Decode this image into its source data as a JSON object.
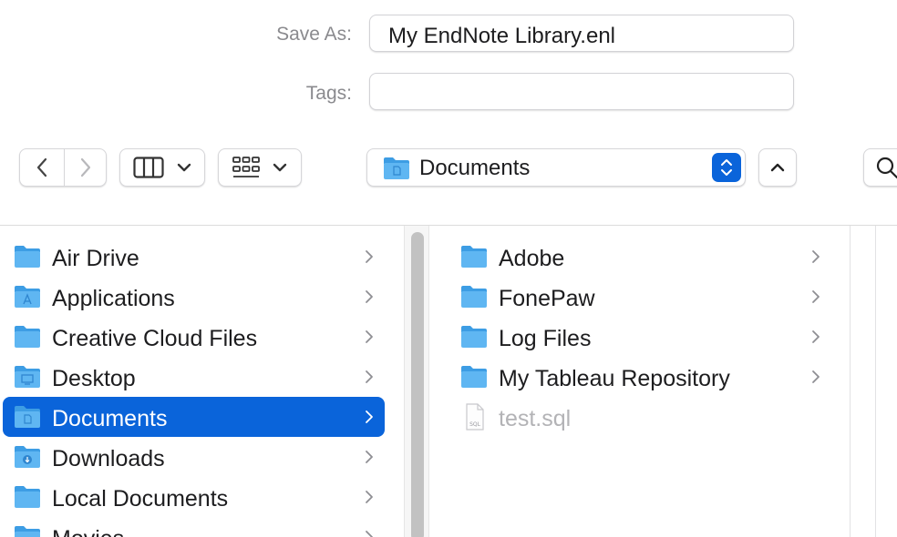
{
  "save_as": {
    "label": "Save As:",
    "value": "My EndNote Library.enl"
  },
  "tags": {
    "label": "Tags:",
    "value": ""
  },
  "location": {
    "current": "Documents"
  },
  "sidebar": {
    "items": [
      {
        "label": "Air Drive",
        "icon": "folder-icon"
      },
      {
        "label": "Applications",
        "icon": "applications-folder-icon"
      },
      {
        "label": "Creative Cloud Files",
        "icon": "folder-icon"
      },
      {
        "label": "Desktop",
        "icon": "desktop-folder-icon"
      },
      {
        "label": "Documents",
        "icon": "documents-folder-icon",
        "selected": true
      },
      {
        "label": "Downloads",
        "icon": "downloads-folder-icon"
      },
      {
        "label": "Local Documents",
        "icon": "folder-icon"
      },
      {
        "label": "Movies",
        "icon": "movies-folder-icon"
      }
    ]
  },
  "documents": {
    "items": [
      {
        "label": "Adobe",
        "icon": "folder-icon"
      },
      {
        "label": "FonePaw",
        "icon": "folder-icon"
      },
      {
        "label": "Log Files",
        "icon": "folder-icon"
      },
      {
        "label": "My Tableau Repository",
        "icon": "folder-icon"
      },
      {
        "label": "test.sql",
        "icon": "sql-file-icon",
        "file_badge": "SQL"
      }
    ]
  },
  "colors": {
    "accent": "#0a64da",
    "folder": "#5fb6f2",
    "folder_tab": "#3d9de4",
    "label_gray": "#8a8a8e",
    "disabled_text": "#b3b3b6"
  }
}
